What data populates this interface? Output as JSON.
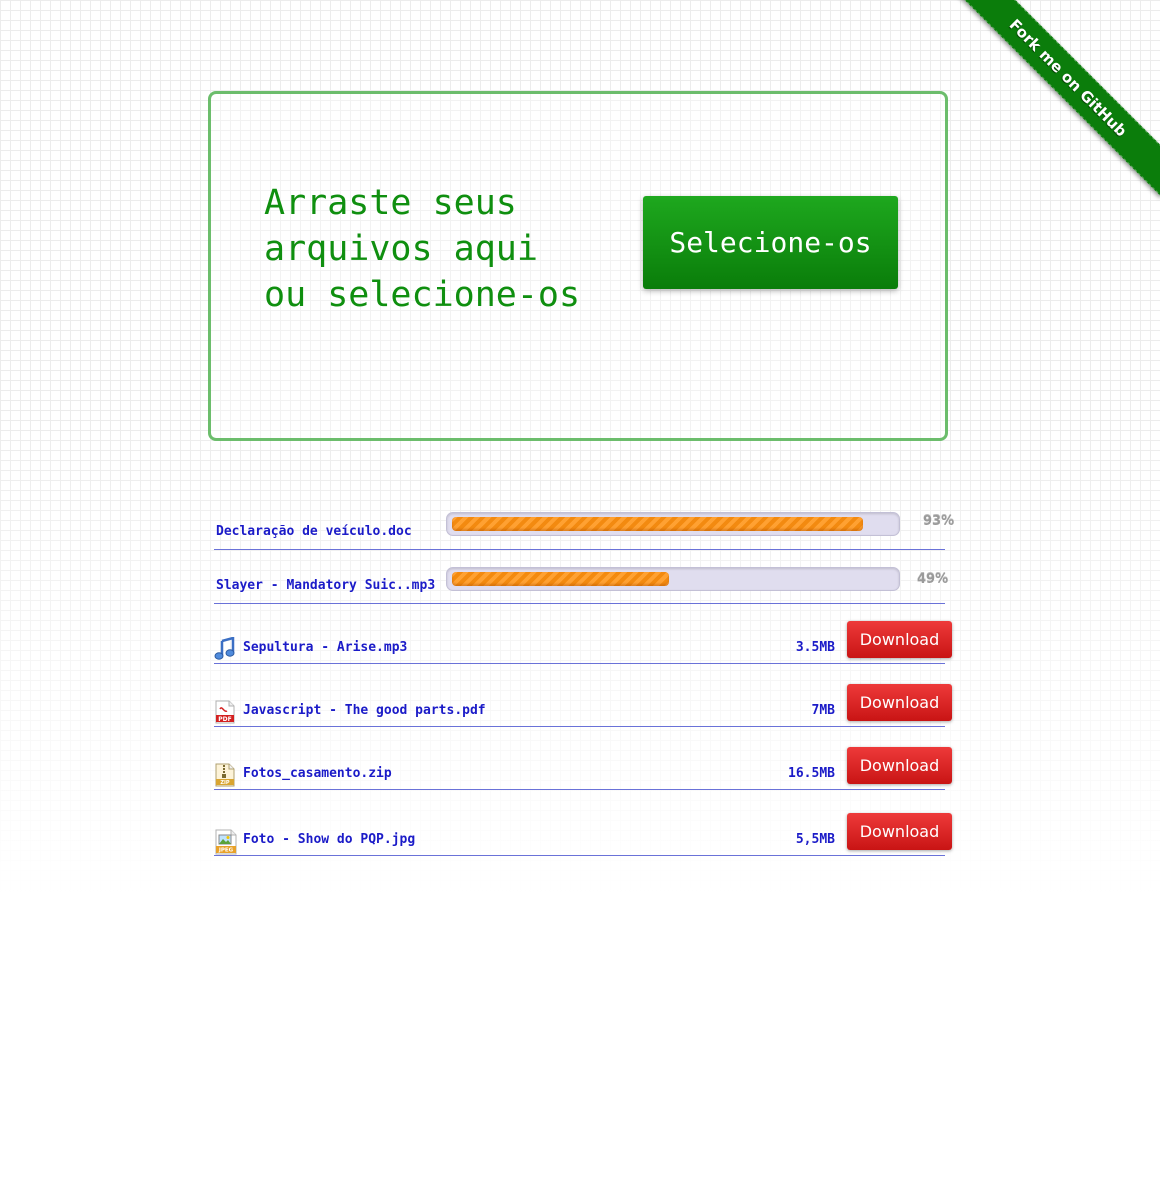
{
  "ribbon": {
    "label": "Fork me on GitHub",
    "color": "#0b7d0b"
  },
  "dropzone": {
    "text": "Arraste seus\narquivos aqui\nou selecione-os",
    "select_button": "Selecione-os",
    "border_color": "#6cbd6c",
    "text_color": "#0f8f0f"
  },
  "uploads": [
    {
      "name": "Declaração de veículo.doc",
      "progress": 93,
      "percent_label": "93%"
    },
    {
      "name": "Slayer - Mandatory Suic..mp3",
      "progress": 49,
      "percent_label": "49%"
    }
  ],
  "files": [
    {
      "icon": "music-note-icon",
      "name": "Sepultura - Arise.mp3",
      "size": "3.5MB",
      "button": "Download"
    },
    {
      "icon": "pdf-file-icon",
      "name": "Javascript - The good parts.pdf",
      "size": "7MB",
      "button": "Download"
    },
    {
      "icon": "zip-file-icon",
      "name": "Fotos_casamento.zip",
      "size": "16.5MB",
      "button": "Download"
    },
    {
      "icon": "jpeg-file-icon",
      "name": "Foto - Show do PQP.jpg",
      "size": "5,5MB",
      "button": "Download"
    }
  ],
  "colors": {
    "link_text": "#1b1bc8",
    "download_button": "#d61f1f",
    "select_button": "#0f8f0f",
    "progress_fill": "#f79a22"
  }
}
